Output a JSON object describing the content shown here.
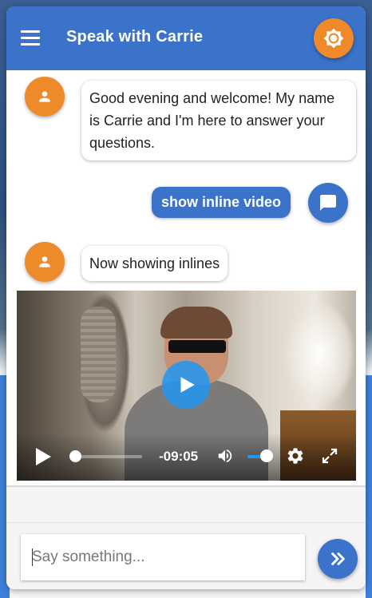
{
  "header": {
    "title": "Speak with Carrie",
    "menu_icon": "hamburger-menu-icon",
    "theme_icon": "brightness-icon"
  },
  "messages": [
    {
      "from": "bot",
      "text": "Good evening and welcome! My name is Carrie and I'm here to answer your questions."
    },
    {
      "from": "user",
      "text": "show inline video"
    },
    {
      "from": "bot",
      "text": "Now showing inlines"
    }
  ],
  "video": {
    "time_remaining": "-09:05",
    "progress": 0,
    "volume": 0.7
  },
  "input": {
    "placeholder": "Say something...",
    "value": ""
  },
  "colors": {
    "primary": "#3a73c9",
    "accent": "#ef8a2b",
    "video_accent": "#2196f3"
  }
}
